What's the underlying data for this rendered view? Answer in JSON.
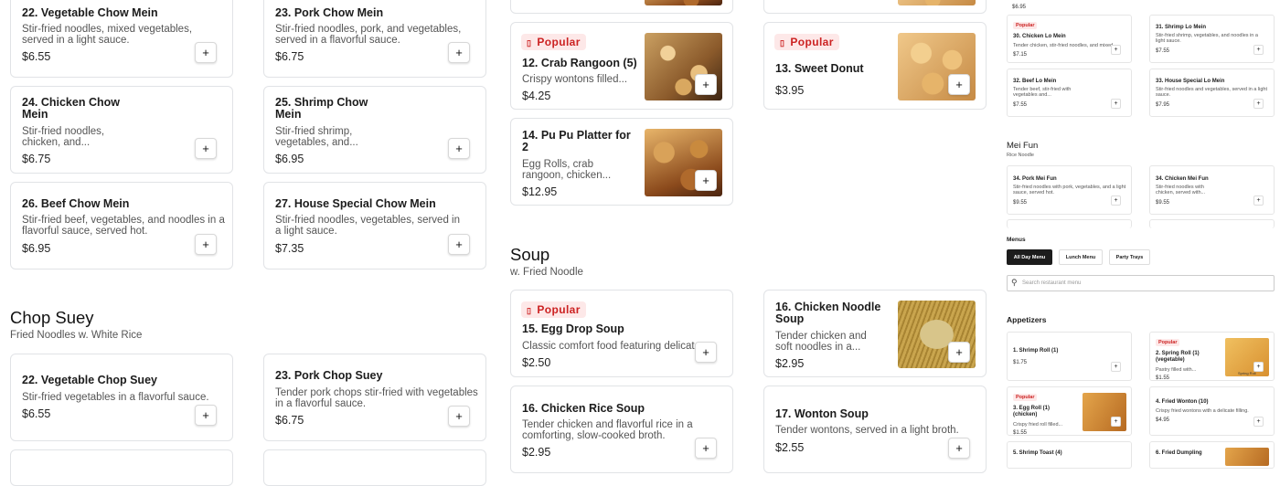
{
  "col1": [
    {
      "title": "22. Vegetable Chow Mein",
      "desc": "Stir-fried noodles, mixed vegetables, served in a light sauce.",
      "price": "$6.55"
    },
    {
      "title": "24. Chicken Chow Mein",
      "desc": "Stir-fried noodles, chicken, and...",
      "price": "$6.75"
    },
    {
      "title": "26. Beef Chow Mein",
      "desc": "Stir-fried beef, vegetables, and noodles in a flavorful sauce, served hot.",
      "price": "$6.95"
    }
  ],
  "col2": [
    {
      "title": "23. Pork Chow Mein",
      "desc": "Stir-fried noodles, pork, and vegetables, served in a flavorful sauce.",
      "price": "$6.75"
    },
    {
      "title": "25. Shrimp Chow Mein",
      "desc": "Stir-fried shrimp, vegetables, and...",
      "price": "$6.95"
    },
    {
      "title": "27. House Special Chow Mein",
      "desc": "Stir-fried noodles, vegetables, served in a light sauce.",
      "price": "$7.35"
    }
  ],
  "chopsuey": {
    "title": "Chop Suey",
    "subtitle": "Fried Noodles w. White Rice",
    "items": [
      {
        "title": "22. Vegetable Chop Suey",
        "desc": "Stir-fried vegetables in a flavorful sauce.",
        "price": "$6.55"
      },
      {
        "title": "23. Pork Chop Suey",
        "desc": "Tender pork chops stir-fried with vegetables in a flavorful sauce.",
        "price": "$6.75"
      }
    ]
  },
  "popular_label": "Popular",
  "appetizers": [
    {
      "title": "12. Crab Rangoon (5)",
      "desc": "Crispy wontons filled...",
      "price": "$4.25"
    },
    {
      "title": "13. Sweet Donut",
      "desc": "",
      "price": "$3.95"
    },
    {
      "title": "14. Pu Pu Platter for 2",
      "desc": "Egg Rolls, crab rangoon, chicken...",
      "price": "$12.95"
    }
  ],
  "soup": {
    "title": "Soup",
    "subtitle": "w. Fried Noodle",
    "items": [
      {
        "title": "15. Egg Drop Soup",
        "desc": "Classic comfort food featuring delicate",
        "price": "$2.50"
      },
      {
        "title": "16. Chicken Noodle Soup",
        "desc": "Tender chicken and soft noodles in a...",
        "price": "$2.95"
      },
      {
        "title": "16. Chicken Rice Soup",
        "desc": "Tender chicken and flavorful rice in a comforting, slow-cooked broth.",
        "price": "$2.95"
      },
      {
        "title": "17. Wonton Soup",
        "desc": "Tender wontons, served in a light broth.",
        "price": "$2.55"
      }
    ]
  },
  "right": {
    "top_price": "$6.95",
    "lomein": [
      {
        "title": "30. Chicken Lo Mein",
        "desc": "Tender chicken, stir-fried noodles, and mixed...",
        "price": "$7.15",
        "popular": true
      },
      {
        "title": "31. Shrimp Lo Mein",
        "desc": "Stir-fried shrimp, vegetables, and noodles in a light sauce.",
        "price": "$7.55"
      },
      {
        "title": "32. Beef Lo Mein",
        "desc": "Tender beef, stir-fried with vegetables and...",
        "price": "$7.55"
      },
      {
        "title": "33. House Special Lo Mein",
        "desc": "Stir-fried noodles and vegetables, served in a light sauce.",
        "price": "$7.95"
      }
    ],
    "meifun": {
      "title": "Mei Fun",
      "subtitle": "Rice Noodle",
      "items": [
        {
          "title": "34. Pork Mei Fun",
          "desc": "Stir-fried noodles with pork, vegetables, and a light sauce, served hot.",
          "price": "$9.55"
        },
        {
          "title": "34. Chicken Mei Fun",
          "desc": "Stir-fried noodles with chicken, served with...",
          "price": "$9.55"
        }
      ]
    },
    "menus": {
      "title": "Menus",
      "tabs": [
        "All Day Menu",
        "Lunch Menu",
        "Party Trays"
      ]
    },
    "search_placeholder": "Search restaurant menu",
    "appetizers": {
      "title": "Appetizers",
      "items": [
        {
          "title": "1. Shrimp Roll (1)",
          "desc": "",
          "price": "$1.75"
        },
        {
          "title": "2. Spring Roll (1) (vegetable)",
          "desc": "Pastry filled with...",
          "price": "$1.55",
          "popular": true,
          "img_caption": "Spring Roll"
        },
        {
          "title": "3. Egg Roll (1) (chicken)",
          "desc": "Crispy fried roll filled...",
          "price": "$1.55",
          "popular": true
        },
        {
          "title": "4. Fried Wonton (10)",
          "desc": "Crispy fried wontons with a delicate filling.",
          "price": "$4.95"
        },
        {
          "title": "5. Shrimp Toast (4)",
          "desc": "",
          "price": ""
        },
        {
          "title": "6. Fried Dumpling",
          "desc": "",
          "price": ""
        }
      ]
    }
  },
  "add_symbol": "+",
  "fire_symbol": "▯",
  "search_symbol": "⚲"
}
